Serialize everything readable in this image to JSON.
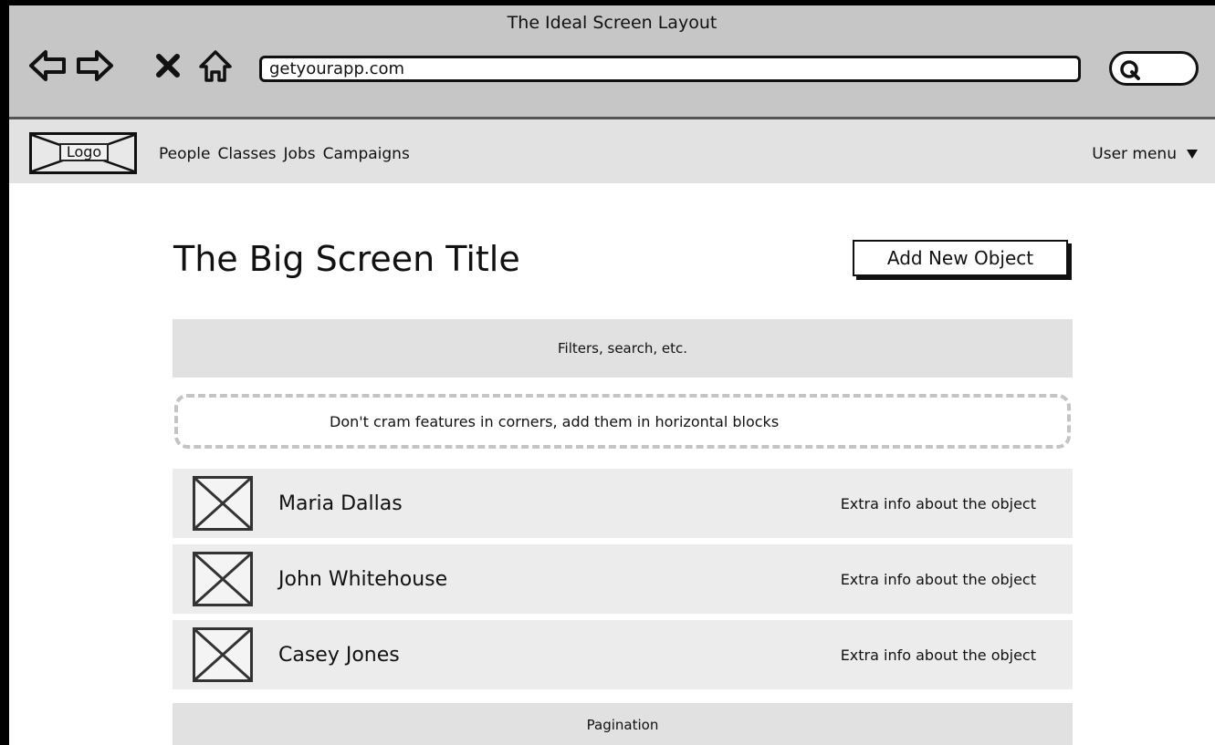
{
  "window": {
    "title": "The Ideal Screen Layout"
  },
  "browser": {
    "url": "getyourapp.com",
    "nav_icons": [
      "back-arrow-icon",
      "forward-arrow-icon",
      "stop-icon",
      "home-icon"
    ],
    "search_icon": "search-icon"
  },
  "navbar": {
    "logo_label": "Logo",
    "links": [
      "People",
      "Classes",
      "Jobs",
      "Campaigns"
    ],
    "user_menu_label": "User menu"
  },
  "main": {
    "title": "The Big Screen Title",
    "add_button_label": "Add New Object",
    "filters_label": "Filters, search, etc.",
    "hint_text": "Don't cram features in corners, add them in horizontal blocks",
    "rows": [
      {
        "name": "Maria Dallas",
        "extra": "Extra info about the object"
      },
      {
        "name": "John Whitehouse",
        "extra": "Extra info about the object"
      },
      {
        "name": "Casey Jones",
        "extra": "Extra info about the object"
      }
    ],
    "pagination_label": "Pagination"
  },
  "colors": {
    "chrome_background": "#c6c6c6",
    "navbar_background": "#e2e2e2",
    "block_background": "#e1e1e1",
    "row_background": "#ececec"
  }
}
